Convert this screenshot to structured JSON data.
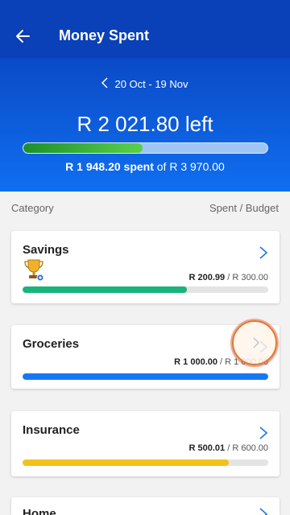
{
  "appbar": {
    "title": "Money Spent",
    "back_icon": "arrow-left-icon"
  },
  "summary": {
    "period": "20 Oct - 19 Nov",
    "left_amount": "R 2 021.80 left",
    "spent": "R 1 948.20 spent",
    "of_label": "of",
    "budget": "R 3 970.00",
    "progress_fraction": 0.49
  },
  "columns": {
    "category": "Category",
    "spent_budget": "Spent / Budget"
  },
  "categories": [
    {
      "name": "Savings",
      "spent": "R 200.99",
      "budget": "R 300.00",
      "progress": 0.67,
      "color": "#19b37c",
      "icon": "trophy-icon"
    },
    {
      "name": "Groceries",
      "spent": "R 1 000.00",
      "budget": "R 1 000.00",
      "progress": 1.0,
      "color": "#1677f2"
    },
    {
      "name": "Insurance",
      "spent": "R 500.01",
      "budget": "R 600.00",
      "progress": 0.84,
      "color": "#f2c21b"
    },
    {
      "name": "Home"
    }
  ],
  "separator": " / "
}
